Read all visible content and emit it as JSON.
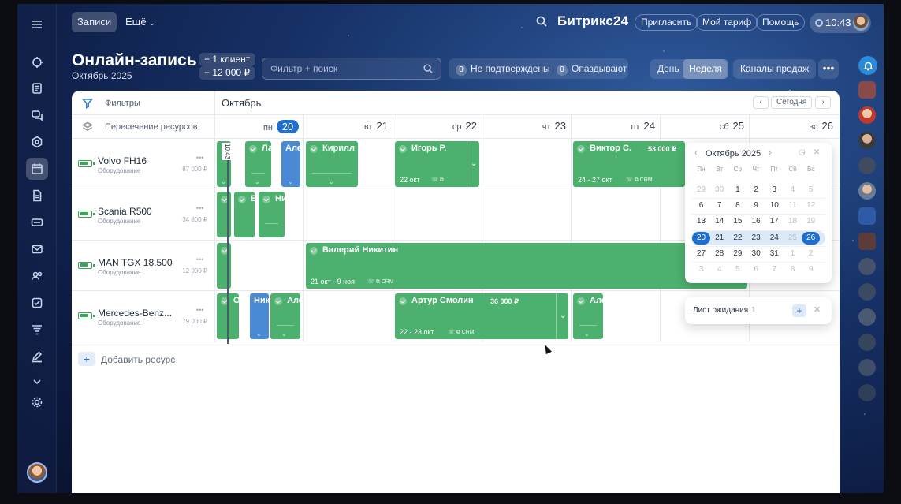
{
  "topbar": {
    "tabs": [
      {
        "label": "Записи"
      },
      {
        "label": "Ещё"
      }
    ],
    "logo": "Битрикс24",
    "invite": "Пригласить",
    "plan": "Мой тариф",
    "help": "Помощь",
    "time": "10:43"
  },
  "header": {
    "title": "Онлайн-запись",
    "subtitle": "Октябрь 2025",
    "clients": "+ 1 клиент",
    "revenue": "+ 12 000 ₽",
    "search_placeholder": "Фильтр + поиск",
    "unconfirmed_count": "0",
    "unconfirmed_label": "Не подтверждены",
    "late_count": "0",
    "late_label": "Опаздывают",
    "view_day": "День",
    "view_week": "Неделя",
    "channels": "Каналы продаж",
    "more": "•••"
  },
  "grid": {
    "filters_label": "Фильтры",
    "intersection_label": "Пересечение ресурсов",
    "month": "Октябрь",
    "today_button": "Сегодня",
    "prev": "‹",
    "next": "›",
    "now_time": "10:43",
    "days": [
      {
        "dn": "пн",
        "d": "20"
      },
      {
        "dn": "вт",
        "d": "21"
      },
      {
        "dn": "ср",
        "d": "22"
      },
      {
        "dn": "чт",
        "d": "23"
      },
      {
        "dn": "пт",
        "d": "24"
      },
      {
        "dn": "сб",
        "d": "25"
      },
      {
        "dn": "вс",
        "d": "26"
      }
    ],
    "resources": [
      {
        "name": "Volvo FH16",
        "type": "Оборудование",
        "price": "87 000 ₽"
      },
      {
        "name": "Scania R500",
        "type": "Оборудование",
        "price": "34 800 ₽"
      },
      {
        "name": "MAN TGX 18.500",
        "type": "Оборудование",
        "price": "12 000 ₽"
      },
      {
        "name": "Mercedes-Benz...",
        "type": "Оборудование",
        "price": "79 000 ₽"
      }
    ],
    "add_resource": "Добавить ресурс",
    "bookings": {
      "r0": [
        {
          "name": "",
          "color": "green"
        },
        {
          "name": "Ла",
          "color": "green"
        },
        {
          "name": "Але",
          "color": "blue"
        },
        {
          "name": "Кирилл",
          "color": "green"
        },
        {
          "name": "Игорь Р.",
          "date": "22 окт",
          "color": "green"
        },
        {
          "name": "Виктор С.",
          "price": "53 000 ₽",
          "date": "24 - 27 окт",
          "color": "green"
        }
      ],
      "r1": [
        {
          "name": "",
          "color": "green"
        },
        {
          "name": "В",
          "color": "green"
        },
        {
          "name": "Ни",
          "color": "green"
        }
      ],
      "r2": [
        {
          "name": "",
          "color": "green"
        },
        {
          "name": "Валерий Никитин",
          "date": "21 окт - 9 ноя",
          "color": "green"
        }
      ],
      "r3": [
        {
          "name": "О",
          "color": "green"
        },
        {
          "name": "Ник",
          "color": "blue"
        },
        {
          "name": "Але",
          "color": "green"
        },
        {
          "name": "Артур Смолин",
          "price": "36 000 ₽",
          "date": "22 - 23 окт",
          "color": "green"
        },
        {
          "name": "Але",
          "color": "green"
        }
      ]
    },
    "crm": "CRM"
  },
  "mini_calendar": {
    "title": "Октябрь 2025",
    "weekdays": [
      "Пн",
      "Вт",
      "Ср",
      "Чт",
      "Пт",
      "Сб",
      "Вс"
    ],
    "weeks": [
      [
        "29",
        "30",
        "1",
        "2",
        "3",
        "4",
        "5"
      ],
      [
        "6",
        "7",
        "8",
        "9",
        "10",
        "11",
        "12"
      ],
      [
        "13",
        "14",
        "15",
        "16",
        "17",
        "18",
        "19"
      ],
      [
        "20",
        "21",
        "22",
        "23",
        "24",
        "25",
        "26"
      ],
      [
        "27",
        "28",
        "29",
        "30",
        "31",
        "1",
        "2"
      ],
      [
        "3",
        "4",
        "5",
        "6",
        "7",
        "8",
        "9"
      ]
    ]
  },
  "waiting_list": {
    "label": "Лист ожидания",
    "count": "1",
    "add": "+"
  },
  "colors": {
    "green": "#4cb16e",
    "blue": "#4a89d4",
    "accent": "#1e6fd0"
  }
}
